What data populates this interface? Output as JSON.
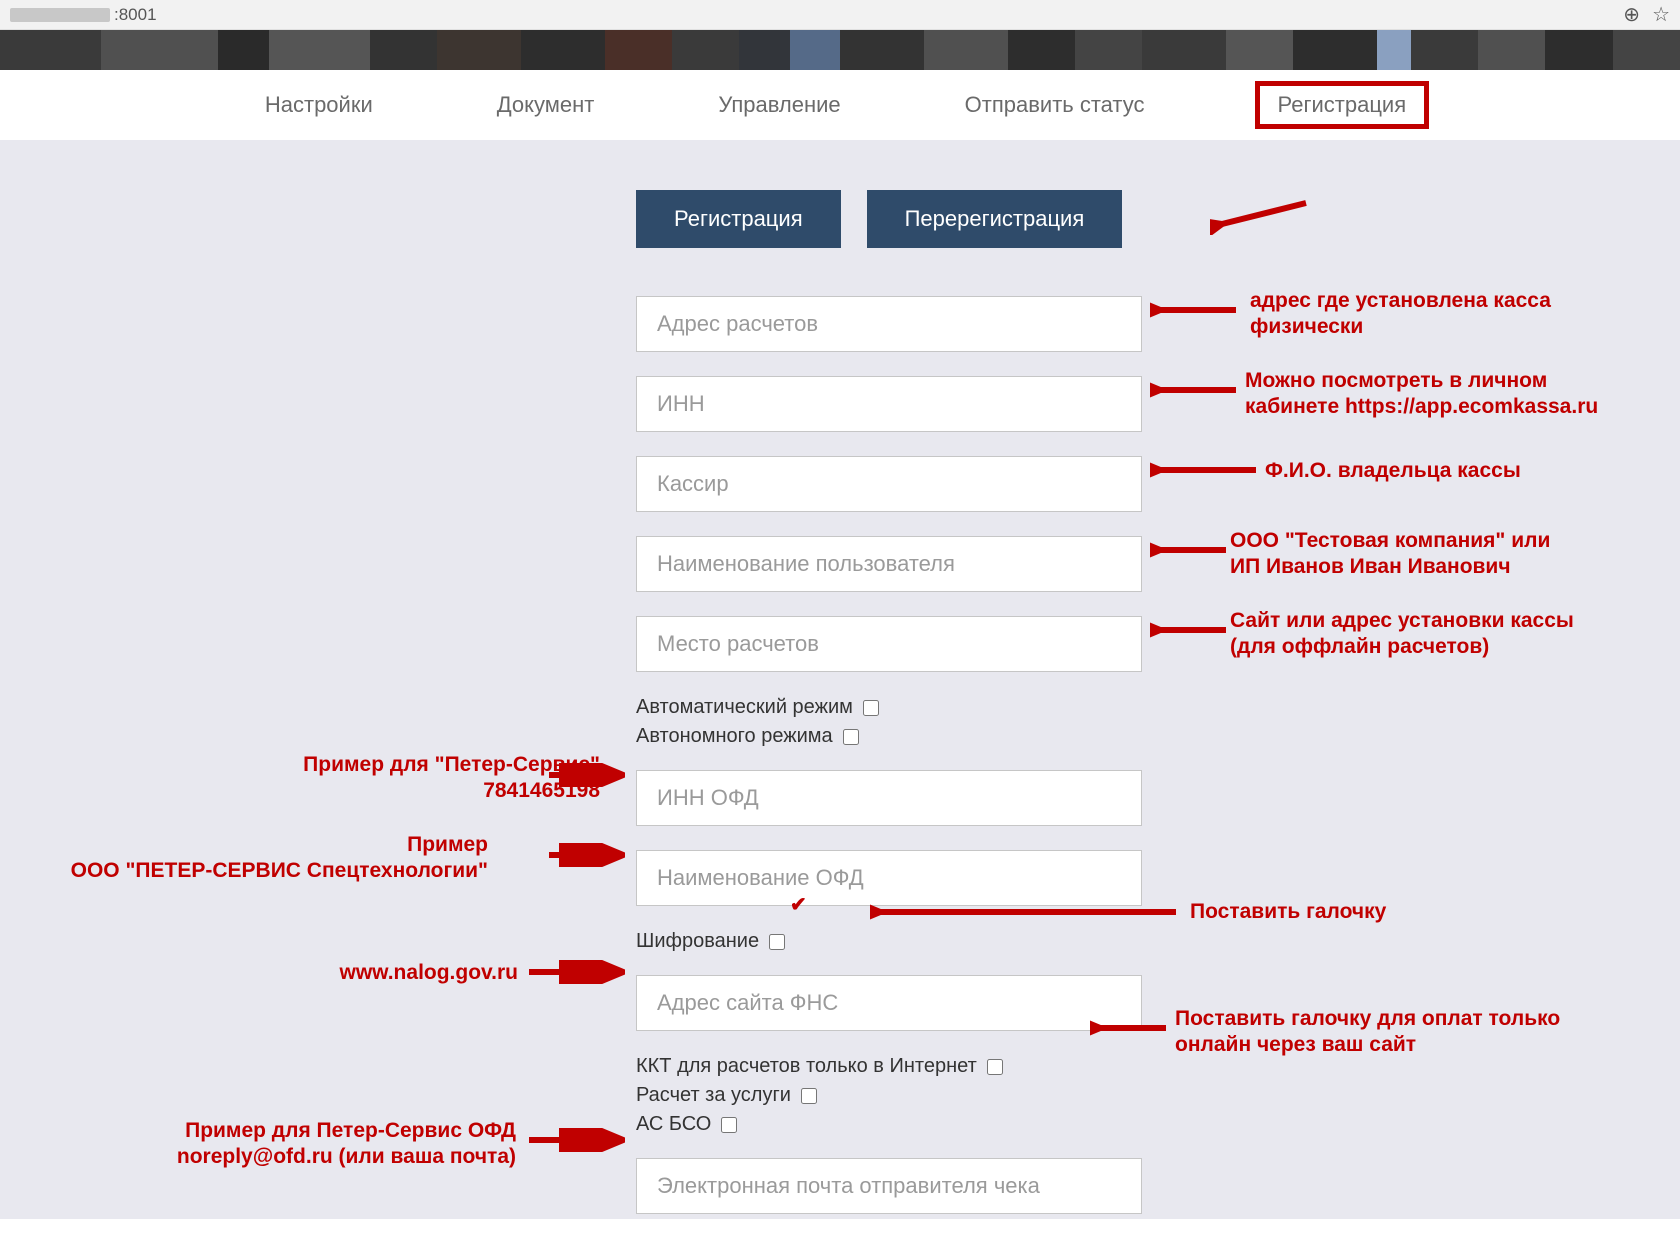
{
  "browser": {
    "url_suffix": ":8001",
    "zoom_icon": "⊕",
    "star_icon": "☆"
  },
  "nav": {
    "items": [
      {
        "label": "Настройки"
      },
      {
        "label": "Документ"
      },
      {
        "label": "Управление"
      },
      {
        "label": "Отправить статус"
      },
      {
        "label": "Регистрация",
        "active": true
      }
    ]
  },
  "form": {
    "actions": {
      "register": "Регистрация",
      "reregister": "Перерегистрация"
    },
    "inputs": {
      "address": "Адрес расчетов",
      "inn": "ИНН",
      "cashier": "Кассир",
      "username": "Наименование пользователя",
      "place": "Место расчетов",
      "inn_ofd": "ИНН ОФД",
      "name_ofd": "Наименование ОФД",
      "fns_site": "Адрес сайта ФНС",
      "email_sender": "Электронная почта отправителя чека"
    },
    "checks": {
      "auto_mode": "Автоматический режим",
      "autonomous_mode": "Автономного режима",
      "encryption": "Шифрование",
      "kkt_internet": "ККТ для расчетов только в Интернет",
      "services": "Расчет за услуги",
      "as_bso": "АС БСО"
    }
  },
  "annotations": {
    "right": {
      "address": "адрес где установлена касса\nфизически",
      "inn": "Можно посмотреть в личном\nкабинете https://app.ecomkassa.ru",
      "cashier": "Ф.И.О. владельца кассы",
      "username": "ООО \"Тестовая компания\" или\nИП Иванов Иван Иванович",
      "place": "Сайт или адрес установки кассы\n(для оффлайн расчетов)",
      "encryption": "Поставить галочку",
      "kkt_internet": "Поставить галочку для оплат только\nонлайн через ваш сайт"
    },
    "left": {
      "inn_ofd": "Пример для \"Петер-Сервис\"\n7841465198",
      "name_ofd": "Пример\nООО \"ПЕТЕР-СЕРВИС Спецтехнологии\"",
      "fns_site": "www.nalog.gov.ru",
      "email_sender": "Пример для Петер-Сервис ОФД\nnoreply@ofd.ru (или ваша почта)"
    }
  }
}
